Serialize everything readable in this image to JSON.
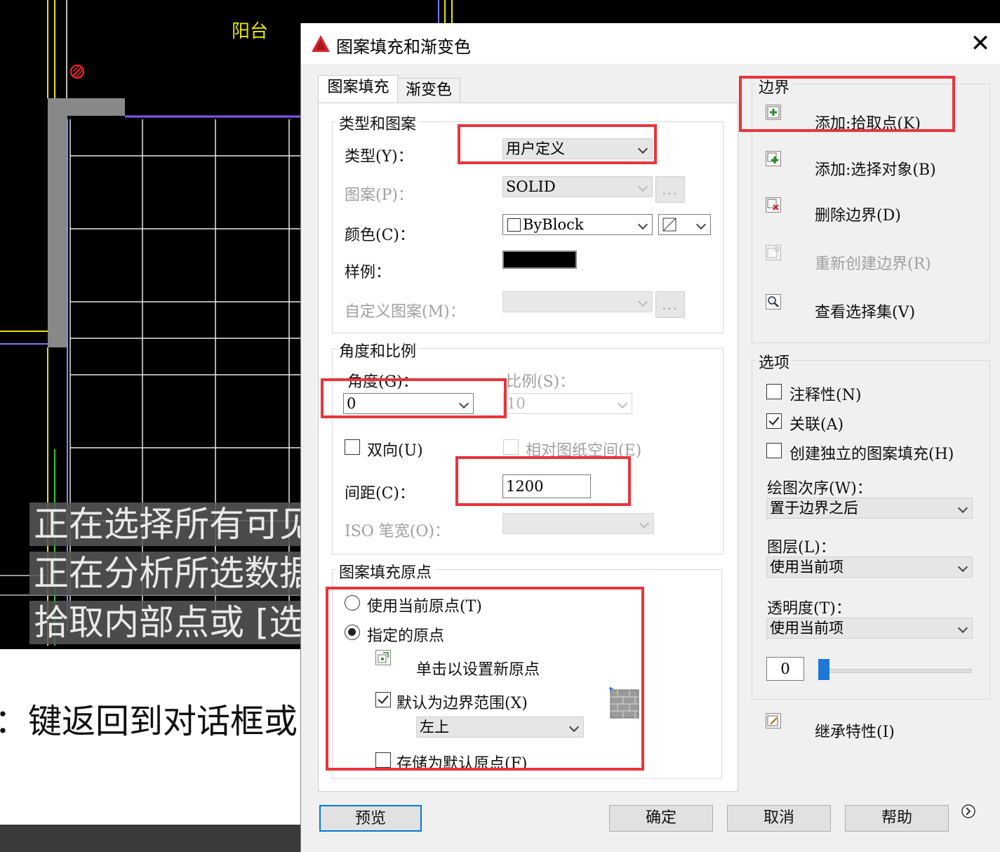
{
  "cad": {
    "balcony_label": "阳台",
    "cmd_lines": [
      "正在选择所有可见",
      "正在分析所选数据",
      "拾取内部点或 [选"
    ],
    "bottom_text": "：键返回到对话框或"
  },
  "dialog": {
    "title": "图案填充和渐变色",
    "close": "✕",
    "tabs": [
      "图案填充",
      "渐变色"
    ],
    "type_pattern": {
      "title": "类型和图案",
      "type_label": "类型(Y)：",
      "type_value": "用户定义",
      "pattern_label": "图案(P)：",
      "pattern_value": "SOLID",
      "color_label": "颜色(C)：",
      "color_value": "ByBlock",
      "sample_label": "样例：",
      "custom_label": "自定义图案(M)：",
      "browse": "..."
    },
    "angle_scale": {
      "title": "角度和比例",
      "angle_label": "角度(G)：",
      "angle_value": "0",
      "scale_label": "比例(S)：",
      "scale_value": "10",
      "double_label": "双向(U)",
      "relative_label": "相对图纸空间(E)",
      "spacing_label": "间距(C)：",
      "spacing_value": "1200",
      "iso_label": "ISO 笔宽(O)："
    },
    "origin": {
      "title": "图案填充原点",
      "use_current": "使用当前原点(T)",
      "specified": "指定的原点",
      "click_set": "单击以设置新原点",
      "default_extent": "默认为边界范围(X)",
      "extent_value": "左上",
      "store_default": "存储为默认原点(F)"
    },
    "boundary": {
      "title": "边界",
      "add_pick": "添加:拾取点(K)",
      "add_select": "添加:选择对象(B)",
      "remove": "删除边界(D)",
      "recreate": "重新创建边界(R)",
      "view": "查看选择集(V)"
    },
    "options": {
      "title": "选项",
      "annotative": "注释性(N)",
      "associative": "关联(A)",
      "separate": "创建独立的图案填充(H)",
      "draw_order_label": "绘图次序(W)：",
      "draw_order_value": "置于边界之后",
      "layer_label": "图层(L)：",
      "layer_value": "使用当前项",
      "transparency_label": "透明度(T)：",
      "transparency_value": "使用当前项",
      "transparency_amount": "0"
    },
    "inherit": "继承特性(I)",
    "buttons": {
      "preview": "预览",
      "ok": "确定",
      "cancel": "取消",
      "help": "帮助"
    }
  }
}
